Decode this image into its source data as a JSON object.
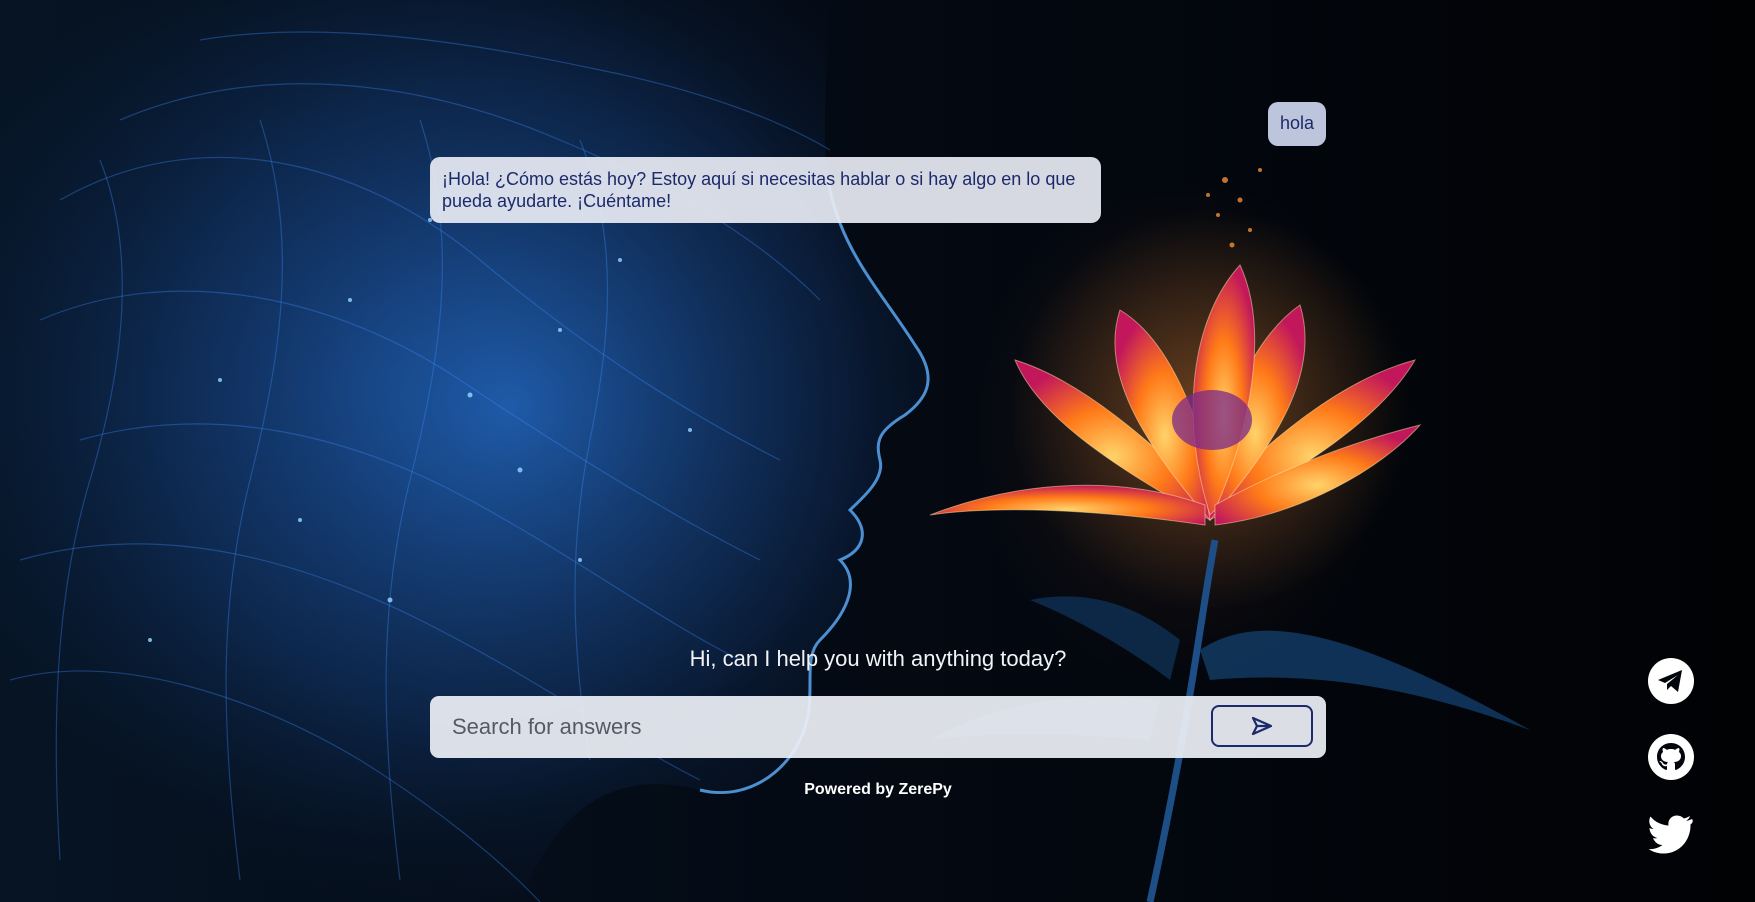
{
  "chat": {
    "user_message": "hola",
    "bot_message": "¡Hola! ¿Cómo estás hoy? Estoy aquí si necesitas hablar o si hay algo en lo que pueda ayudarte. ¡Cuéntame!"
  },
  "greeting": "Hi, can I help you with anything today?",
  "search": {
    "placeholder": "Search for answers",
    "value": "",
    "send_icon": "send-arrow-icon"
  },
  "footer": {
    "powered_by": "Powered by ZerePy"
  },
  "social_links": [
    {
      "name": "telegram",
      "icon": "telegram-icon"
    },
    {
      "name": "github",
      "icon": "github-icon"
    },
    {
      "name": "twitter",
      "icon": "twitter-icon"
    }
  ],
  "colors": {
    "bubble_text": "#1c2a6b",
    "bubble_bg": "#e8ecf4",
    "page_bg": "#02050b",
    "glow_blue": "#2f8bff",
    "flower_orange": "#ff7a18"
  }
}
